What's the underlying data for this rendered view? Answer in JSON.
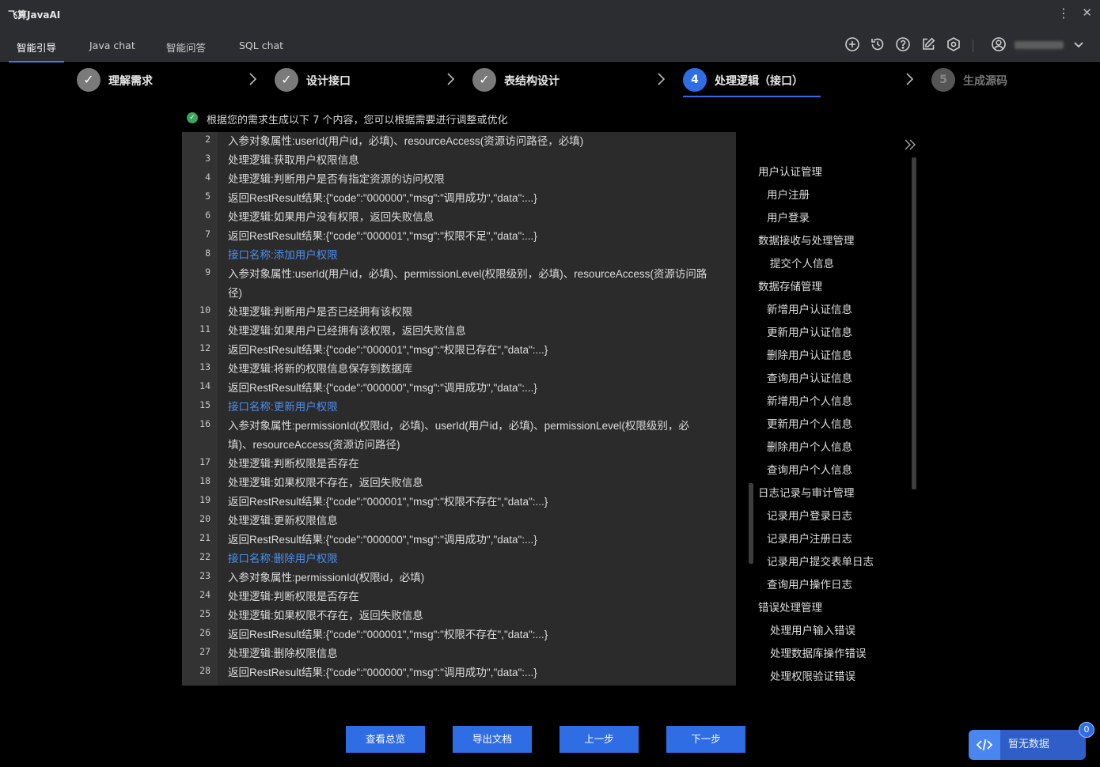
{
  "app": {
    "title": "飞算JavaAI"
  },
  "tabs": [
    {
      "label": "智能引导",
      "active": true
    },
    {
      "label": "Java chat",
      "active": false
    },
    {
      "label": "智能问答",
      "active": false
    },
    {
      "label": "SQL chat",
      "active": false
    }
  ],
  "toolbar_icons": [
    "plus-circle-icon",
    "history-icon",
    "help-icon",
    "edit-icon",
    "settings-icon",
    "user-icon",
    "chevron-down-icon"
  ],
  "steps": [
    {
      "label": "理解需求",
      "state": "done"
    },
    {
      "label": "设计接口",
      "state": "done"
    },
    {
      "label": "表结构设计",
      "state": "done"
    },
    {
      "number": "4",
      "label": "处理逻辑（接口）",
      "state": "current"
    },
    {
      "number": "5",
      "label": "生成源码",
      "state": "future"
    }
  ],
  "info": {
    "text": "根据您的需求生成以下 7 个内容，您可以根据需要进行调整或优化"
  },
  "code_lines": [
    {
      "n": "2",
      "text": "入参对象属性:userId(用户id，必填)、resourceAccess(资源访问路径，必填)"
    },
    {
      "n": "3",
      "text": "处理逻辑:获取用户权限信息"
    },
    {
      "n": "4",
      "text": "处理逻辑:判断用户是否有指定资源的访问权限"
    },
    {
      "n": "5",
      "text": "返回RestResult结果:{\"code\":\"000000\",\"msg\":\"调用成功\",\"data\":...}"
    },
    {
      "n": "6",
      "text": "处理逻辑:如果用户没有权限，返回失败信息"
    },
    {
      "n": "7",
      "text": "返回RestResult结果:{\"code\":\"000001\",\"msg\":\"权限不足\",\"data\":...}"
    },
    {
      "n": "8",
      "text": "接口名称:添加用户权限",
      "link": true
    },
    {
      "n": "9",
      "text": "入参对象属性:userId(用户id，必填)、permissionLevel(权限级别，必填)、resourceAccess(资源访问路径)"
    },
    {
      "n": "10",
      "text": "处理逻辑:判断用户是否已经拥有该权限"
    },
    {
      "n": "11",
      "text": "处理逻辑:如果用户已经拥有该权限，返回失败信息"
    },
    {
      "n": "12",
      "text": "返回RestResult结果:{\"code\":\"000001\",\"msg\":\"权限已存在\",\"data\":...}"
    },
    {
      "n": "13",
      "text": "处理逻辑:将新的权限信息保存到数据库"
    },
    {
      "n": "14",
      "text": "返回RestResult结果:{\"code\":\"000000\",\"msg\":\"调用成功\",\"data\":...}"
    },
    {
      "n": "15",
      "text": "接口名称:更新用户权限",
      "link": true
    },
    {
      "n": "16",
      "text": "入参对象属性:permissionId(权限id，必填)、userId(用户id，必填)、permissionLevel(权限级别，必填)、resourceAccess(资源访问路径)"
    },
    {
      "n": "17",
      "text": "处理逻辑:判断权限是否存在"
    },
    {
      "n": "18",
      "text": "处理逻辑:如果权限不存在，返回失败信息"
    },
    {
      "n": "19",
      "text": "返回RestResult结果:{\"code\":\"000001\",\"msg\":\"权限不存在\",\"data\":...}"
    },
    {
      "n": "20",
      "text": "处理逻辑:更新权限信息"
    },
    {
      "n": "21",
      "text": "返回RestResult结果:{\"code\":\"000000\",\"msg\":\"调用成功\",\"data\":...}"
    },
    {
      "n": "22",
      "text": "接口名称:删除用户权限",
      "link": true
    },
    {
      "n": "23",
      "text": "入参对象属性:permissionId(权限id，必填)"
    },
    {
      "n": "24",
      "text": "处理逻辑:判断权限是否存在"
    },
    {
      "n": "25",
      "text": "处理逻辑:如果权限不存在，返回失败信息"
    },
    {
      "n": "26",
      "text": "返回RestResult结果:{\"code\":\"000001\",\"msg\":\"权限不存在\",\"data\":...}"
    },
    {
      "n": "27",
      "text": "处理逻辑:删除权限信息"
    },
    {
      "n": "28",
      "text": "返回RestResult结果:{\"code\":\"000000\",\"msg\":\"调用成功\",\"data\":...}"
    }
  ],
  "outline": [
    {
      "label": "用户认证管理",
      "level": 1
    },
    {
      "label": "用户注册",
      "level": 2
    },
    {
      "label": "用户登录",
      "level": 2
    },
    {
      "label": "数据接收与处理管理",
      "level": 1
    },
    {
      "label": "提交个人信息",
      "level": 3
    },
    {
      "label": "数据存储管理",
      "level": 1
    },
    {
      "label": "新增用户认证信息",
      "level": 2
    },
    {
      "label": "更新用户认证信息",
      "level": 2
    },
    {
      "label": "删除用户认证信息",
      "level": 2
    },
    {
      "label": "查询用户认证信息",
      "level": 2
    },
    {
      "label": "新增用户个人信息",
      "level": 2
    },
    {
      "label": "更新用户个人信息",
      "level": 2
    },
    {
      "label": "删除用户个人信息",
      "level": 2
    },
    {
      "label": "查询用户个人信息",
      "level": 2
    },
    {
      "label": "日志记录与审计管理",
      "level": 1
    },
    {
      "label": "记录用户登录日志",
      "level": 2
    },
    {
      "label": "记录用户注册日志",
      "level": 2
    },
    {
      "label": "记录用户提交表单日志",
      "level": 2
    },
    {
      "label": "查询用户操作日志",
      "level": 2
    },
    {
      "label": "错误处理管理",
      "level": 1
    },
    {
      "label": "处理用户输入错误",
      "level": 3
    },
    {
      "label": "处理数据库操作错误",
      "level": 3
    },
    {
      "label": "处理权限验证错误",
      "level": 3
    }
  ],
  "buttons": {
    "overview": "查看总览",
    "export": "导出文档",
    "prev": "上一步",
    "next": "下一步"
  },
  "widget": {
    "label": "暂无数据",
    "badge": "0"
  },
  "colors": {
    "accent": "#2f6de5",
    "link": "#4c8ff0",
    "success": "#3aa55c"
  }
}
